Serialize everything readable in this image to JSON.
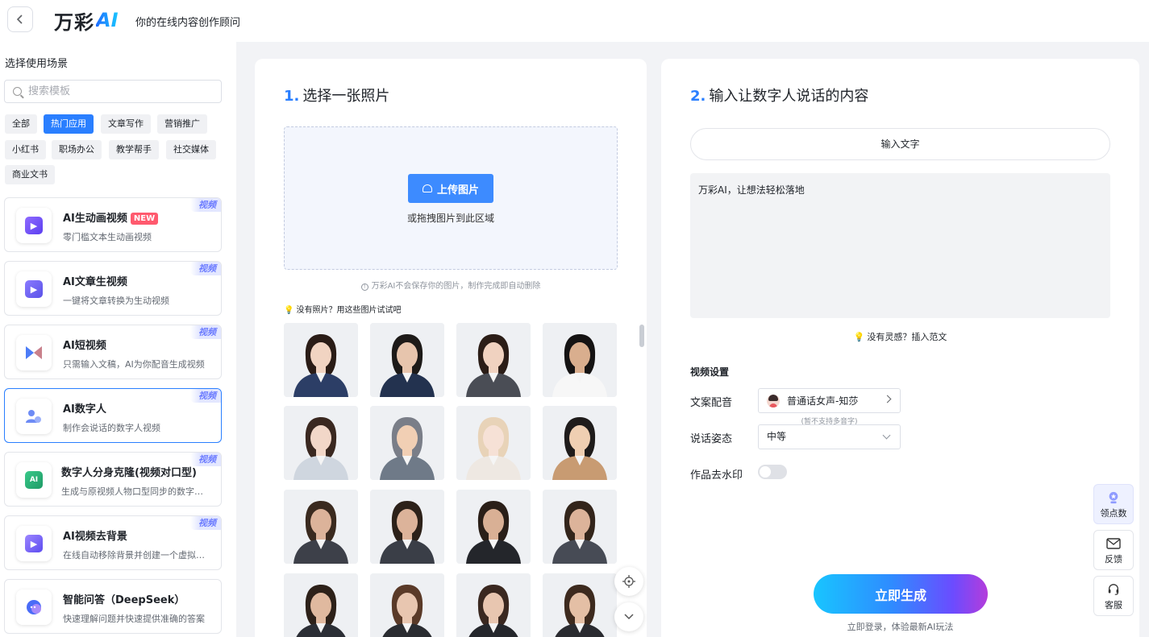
{
  "header": {
    "logo_text": "万彩",
    "logo_ai": "AI",
    "slogan": "你的在线内容创作顾问"
  },
  "sidebar": {
    "title": "选择使用场景",
    "search_placeholder": "搜索模板",
    "tags": [
      "全部",
      "热门应用",
      "文章写作",
      "营销推广",
      "小红书",
      "职场办公",
      "教学帮手",
      "社交媒体",
      "商业文书"
    ],
    "active_tag": "热门应用",
    "cards": [
      {
        "title": "AI生动画视频",
        "desc": "零门槛文本生动画视频",
        "badge": "视频",
        "new": "NEW",
        "color": "#7b5cf5"
      },
      {
        "title": "AI文章生视频",
        "desc": "一键将文章转换为生动视频",
        "badge": "视频",
        "color": "#6b63f2"
      },
      {
        "title": "AI短视频",
        "desc": "只需输入文稿，AI为你配音生成视频",
        "badge": "视频",
        "color": "#5e7cf7"
      },
      {
        "title": "AI数字人",
        "desc": "制作会说话的数字人视频",
        "badge": "视频",
        "color": "#6d8bf5",
        "selected": true
      },
      {
        "title": "数字人分身克隆(视频对口型)",
        "desc": "生成与原视频人物口型同步的数字人视频",
        "badge": "视频",
        "color": "#2fb57c"
      },
      {
        "title": "AI视频去背景",
        "desc": "在线自动移除背景并创建一个虚拟背景视频",
        "badge": "视频",
        "color": "#7a6cf0"
      },
      {
        "title": "智能问答（DeepSeek）",
        "desc": "快速理解问题并快速提供准确的答案",
        "color": "#4a6cf7"
      }
    ]
  },
  "panel1": {
    "step_num": "1.",
    "step_title": "选择一张照片",
    "upload_label": "上传图片",
    "drop_hint": "或拖拽图片到此区域",
    "privacy_note": "万彩AI不会保存你的图片，制作完成即自动删除",
    "try_hint": "没有照片？用这些图片试试吧",
    "photos": [
      {
        "name": "photo-woman-navy-suit",
        "skin": "#f1d4c2",
        "hair": "#2a1c16",
        "cloth": "#2c3e66"
      },
      {
        "name": "photo-man-glasses-suit",
        "skin": "#e7c5ad",
        "hair": "#1d1a18",
        "cloth": "#23324f"
      },
      {
        "name": "photo-woman-dark-blazer",
        "skin": "#f0d2c0",
        "hair": "#2b1d17",
        "cloth": "#4a4d55"
      },
      {
        "name": "photo-man-white-tee",
        "skin": "#d9ae8e",
        "hair": "#151313",
        "cloth": "#f7f7f7"
      },
      {
        "name": "photo-woman-long-hair",
        "skin": "#f2d7c8",
        "hair": "#3a2820",
        "cloth": "#cfd6df"
      },
      {
        "name": "photo-cartoon-boy-glasses",
        "skin": "#f1cfb4",
        "hair": "#7a7e88",
        "cloth": "#6f7a88"
      },
      {
        "name": "photo-cartoon-girl-blonde",
        "skin": "#f6e1d6",
        "hair": "#e8d3b8",
        "cloth": "#eee8e2"
      },
      {
        "name": "photo-cartoon-man-jacket",
        "skin": "#efcfb2",
        "hair": "#1f1c1b",
        "cloth": "#c89b72"
      },
      {
        "name": "photo-man-grey-suit-1",
        "skin": "#dcb39a",
        "hair": "#3a2a1f",
        "cloth": "#3d4049"
      },
      {
        "name": "photo-man-grey-suit-2",
        "skin": "#dcb39a",
        "hair": "#2c2119",
        "cloth": "#3a3e47"
      },
      {
        "name": "photo-man-black-suit",
        "skin": "#d9b095",
        "hair": "#2a1f18",
        "cloth": "#24262b"
      },
      {
        "name": "photo-man-grey-suit-3",
        "skin": "#dcb39a",
        "hair": "#33251b",
        "cloth": "#474b55"
      },
      {
        "name": "photo-man-dark-suit-4",
        "skin": "#e0b99f",
        "hair": "#2d2119",
        "cloth": "#2b2e35"
      },
      {
        "name": "photo-woman-brown-hair",
        "skin": "#e8c6b0",
        "hair": "#5a3a28",
        "cloth": "#2a2c31"
      },
      {
        "name": "photo-woman-blazer-2",
        "skin": "#e8c6b0",
        "hair": "#3a2820",
        "cloth": "#25272c"
      },
      {
        "name": "photo-woman-curly",
        "skin": "#e4bfa5",
        "hair": "#3d2a1e",
        "cloth": "#2a2b30"
      }
    ]
  },
  "panel2": {
    "step_num": "2.",
    "step_title": "输入让数字人说话的内容",
    "tab_label": "输入文字",
    "textarea_value": "万彩AI，让想法轻松落地",
    "insert_hint": "没有灵感？插入范文",
    "settings_title": "视频设置",
    "voice_label": "文案配音",
    "voice_value": "普通话女声-知莎",
    "voice_note": "(暂不支持多音字)",
    "pose_label": "说话姿态",
    "pose_value": "中等",
    "watermark_label": "作品去水印",
    "generate_label": "立即生成",
    "login_hint": "立即登录，体验最新AI玩法"
  },
  "float_panel": {
    "points": "领点数",
    "feedback": "反馈",
    "service": "客服"
  }
}
